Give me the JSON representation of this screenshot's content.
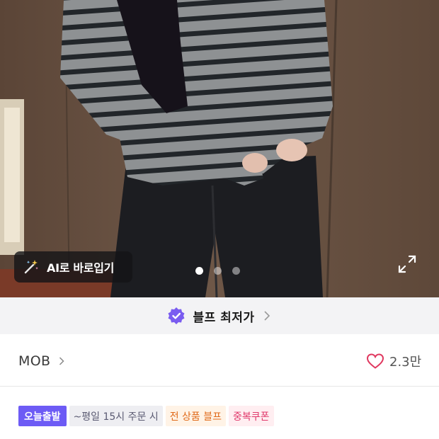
{
  "photo": {
    "ai_button_label": "AI로 바로입기",
    "slide_indicator": {
      "count": 3,
      "active_index": 0
    }
  },
  "banner": {
    "label": "블프 최저가"
  },
  "brand": {
    "name": "MOB"
  },
  "likes": {
    "count": "2.3만"
  },
  "tags": {
    "today": "오늘출발",
    "weekday": "~평일 15시 주문 시",
    "blfe": "전 상품 블프",
    "coupon": "중복쿠폰"
  },
  "colors": {
    "accent_purple": "#6d5bf5",
    "heart": "#e0385f",
    "blfe_text": "#e06a1a",
    "coupon_text": "#e0386a"
  },
  "icons": {
    "ai_button": "magic-wand-icon",
    "banner": "verified-badge-icon",
    "expand": "expand-icon",
    "like": "heart-icon"
  }
}
